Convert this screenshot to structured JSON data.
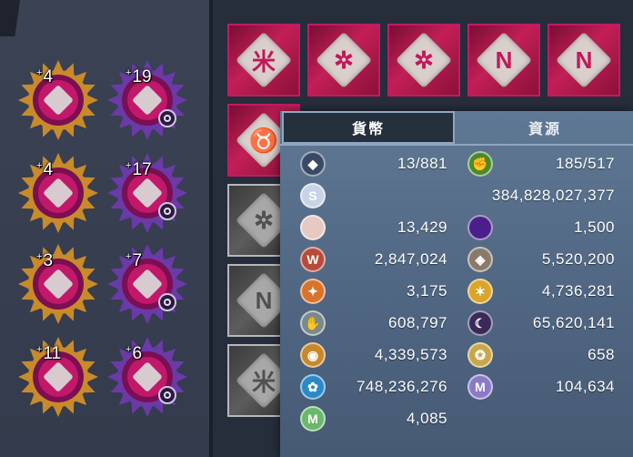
{
  "badges": [
    {
      "count": "4",
      "color": "#c98a2a",
      "row": 0,
      "col": 0,
      "moon": false
    },
    {
      "count": "19",
      "color": "#6b3aa8",
      "row": 0,
      "col": 1,
      "moon": true
    },
    {
      "count": "4",
      "color": "#c98a2a",
      "row": 1,
      "col": 0,
      "moon": false
    },
    {
      "count": "17",
      "color": "#6b3aa8",
      "row": 1,
      "col": 1,
      "moon": true
    },
    {
      "count": "3",
      "color": "#c98a2a",
      "row": 2,
      "col": 0,
      "moon": false
    },
    {
      "count": "7",
      "color": "#6b3aa8",
      "row": 2,
      "col": 1,
      "moon": true
    },
    {
      "count": "11",
      "color": "#c98a2a",
      "row": 3,
      "col": 0,
      "moon": false
    },
    {
      "count": "6",
      "color": "#6b3aa8",
      "row": 3,
      "col": 1,
      "moon": true
    }
  ],
  "badge_plus": "+",
  "rune_tiles": [
    {
      "glyph": "米",
      "style": "pink"
    },
    {
      "glyph": "✲",
      "style": "pink"
    },
    {
      "glyph": "✲",
      "style": "pink"
    },
    {
      "glyph": "N",
      "style": "pink"
    },
    {
      "glyph": "N",
      "style": "pink"
    },
    {
      "glyph": "♉",
      "style": "pink"
    },
    {
      "glyph": "✲",
      "style": "gray"
    },
    {
      "glyph": "N",
      "style": "gray"
    },
    {
      "glyph": "米",
      "style": "gray"
    }
  ],
  "popup": {
    "tab_currency": "貨幣",
    "tab_resources": "資源",
    "rows": [
      {
        "left": {
          "icon": "laurel-rank-icon",
          "color": "#3a4a66",
          "glyph": "◆",
          "value": "13/881"
        },
        "right": {
          "icon": "green-fist-icon",
          "color": "#4b8a2a",
          "glyph": "✊",
          "value": "185/517"
        }
      },
      {
        "wide": {
          "icon": "silver-s-coin-icon",
          "color": "#c8d4e6",
          "glyph": "S",
          "value": "384,828,027,377"
        }
      },
      {
        "left": {
          "icon": "pearl-icon",
          "color": "#e6c9c2",
          "glyph": "",
          "value": "13,429"
        },
        "right": {
          "icon": "purple-orb-icon",
          "color": "#4a1f8a",
          "glyph": "",
          "value": "1,500"
        }
      },
      {
        "left": {
          "icon": "red-crown-card-icon",
          "color": "#b84a3a",
          "glyph": "W",
          "value": "2,847,024"
        },
        "right": {
          "icon": "bronze-rune-icon",
          "color": "#8a7a6a",
          "glyph": "◈",
          "value": "5,520,200"
        }
      },
      {
        "left": {
          "icon": "orange-coin-icon",
          "color": "#d9732a",
          "glyph": "✦",
          "value": "3,175"
        },
        "right": {
          "icon": "gold-pile-icon",
          "color": "#d9a62a",
          "glyph": "✶",
          "value": "4,736,281"
        }
      },
      {
        "left": {
          "icon": "handshake-coin-icon",
          "color": "#7a8a8a",
          "glyph": "✋",
          "value": "608,797"
        },
        "right": {
          "icon": "dark-swirl-icon",
          "color": "#3a2a5a",
          "glyph": "☾",
          "value": "65,620,141"
        }
      },
      {
        "left": {
          "icon": "bronze-coin-icon",
          "color": "#c8882a",
          "glyph": "◉",
          "value": "4,339,573"
        },
        "right": {
          "icon": "medal-icon",
          "color": "#c8a64a",
          "glyph": "✪",
          "value": "658"
        }
      },
      {
        "left": {
          "icon": "blue-gem-coin-icon",
          "color": "#2a8ac8",
          "glyph": "✿",
          "value": "748,236,276"
        },
        "right": {
          "icon": "purple-m-coin-icon",
          "color": "#8a7ac8",
          "glyph": "M",
          "value": "104,634"
        }
      },
      {
        "left": {
          "icon": "green-m-coin-icon",
          "color": "#6ab86a",
          "glyph": "M",
          "value": "4,085"
        }
      }
    ]
  }
}
